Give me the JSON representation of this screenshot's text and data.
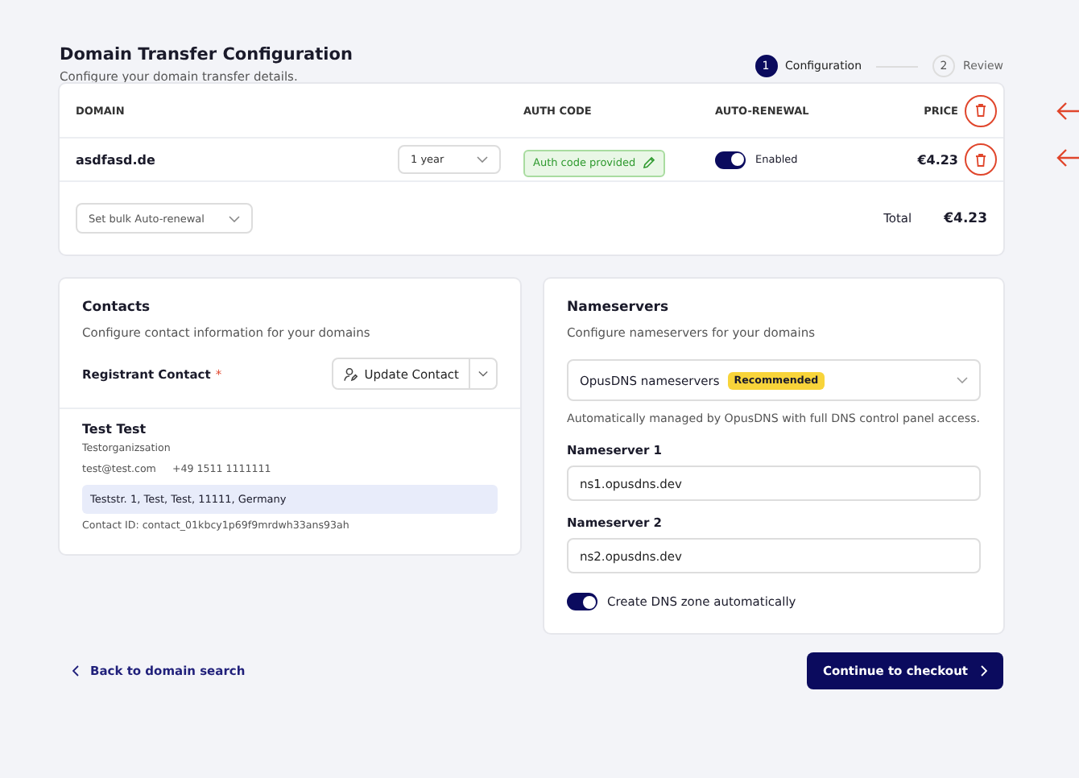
{
  "header": {
    "title": "Domain Transfer Configuration",
    "subtitle": "Configure your domain transfer details."
  },
  "steps": [
    {
      "number": "1",
      "label": "Configuration",
      "selected": true
    },
    {
      "number": "2",
      "label": "Review",
      "selected": false
    }
  ],
  "domains_table": {
    "columns": [
      "DOMAIN",
      "AUTH CODE",
      "AUTO-RENEWAL",
      "PRICE"
    ],
    "rows": [
      {
        "domain": "asdfasd.de",
        "period": "1 year",
        "auth_code": "Auth code provided",
        "auto_renewal_on": true,
        "auto_renewal_label": "Enabled",
        "price": "€4.23"
      }
    ],
    "bulk_select": {
      "placeholder": "Set bulk Auto-renewal"
    },
    "total_label": "Total",
    "total": "€4.23"
  },
  "contacts": {
    "title": "Contacts",
    "subtitle": "Configure contact information for your domains",
    "registrant_label": "Registrant Contact",
    "required_mark": "*",
    "update_button": "Update Contact",
    "contact": {
      "name": "Test Test",
      "organization": "Testorganizsation",
      "email": "test@test.com",
      "phone": "+49 1511 1111111",
      "address": "Teststr. 1, Test, Test, 11111, Germany",
      "contact_id": "Contact ID: contact_01kbcy1p69f9mrdwh33ans93ah"
    }
  },
  "nameservers": {
    "title": "Nameservers",
    "subtitle": "Configure nameservers for your domains",
    "select_value": "OpusDNS nameservers",
    "select_badge": "Recommended",
    "help": "Automatically managed by OpusDNS with full DNS control panel access.",
    "fields": [
      {
        "label": "Nameserver 1",
        "value": "ns1.opusdns.dev"
      },
      {
        "label": "Nameserver 2",
        "value": "ns2.opusdns.dev"
      }
    ],
    "dns_zone_on": true,
    "dns_zone_label": "Create DNS zone automatically"
  },
  "footer": {
    "back_link": "Back to domain search",
    "continue_button": "Continue to checkout"
  }
}
